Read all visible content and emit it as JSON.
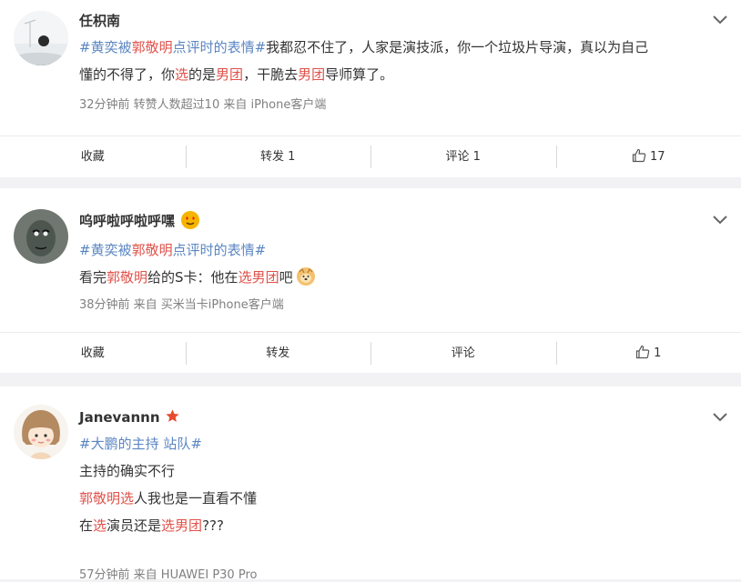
{
  "posts": [
    {
      "username": "任枳南",
      "lines": [
        [
          {
            "t": "#黄奕被",
            "c": "tag"
          },
          {
            "t": "郭敬明",
            "c": "hl"
          },
          {
            "t": "点评时的表情#",
            "c": "tag"
          },
          {
            "t": "我都忍不住了，人家是演技派，你一个垃圾片导演，真以为自己"
          }
        ],
        [
          {
            "t": "懂的不得了，你"
          },
          {
            "t": "选",
            "c": "hl"
          },
          {
            "t": "的是"
          },
          {
            "t": "男团",
            "c": "hl"
          },
          {
            "t": "，干脆去"
          },
          {
            "t": "男团",
            "c": "hl"
          },
          {
            "t": "导师算了。"
          }
        ]
      ],
      "meta": "32分钟前  转赞人数超过10   来自 iPhone客户端",
      "actions": {
        "collect": "收藏",
        "repost": "转发 1",
        "comment": "评论 1",
        "like": "17"
      }
    },
    {
      "username": "呜呼啦呼啦呼嘿",
      "lines": [
        [
          {
            "t": "#黄奕被",
            "c": "tag"
          },
          {
            "t": "郭敬明",
            "c": "hl"
          },
          {
            "t": "点评时的表情#",
            "c": "tag"
          }
        ],
        [
          {
            "t": "看完"
          },
          {
            "t": "郭敬明",
            "c": "hl"
          },
          {
            "t": "给的S卡：他在"
          },
          {
            "t": "选男团",
            "c": "hl"
          },
          {
            "t": "吧"
          }
        ]
      ],
      "meta": "38分钟前  来自 买米当卡iPhone客户端",
      "actions": {
        "collect": "收藏",
        "repost": "转发",
        "comment": "评论",
        "like": "1"
      }
    },
    {
      "username": "Janevannn",
      "lines": [
        [
          {
            "t": "#大鹏的主持 站队#",
            "c": "tag"
          }
        ],
        [
          {
            "t": "主持的确实不行"
          }
        ],
        [
          {
            "t": "郭敬明选",
            "c": "hl"
          },
          {
            "t": "人我也是一直看不懂"
          }
        ],
        [
          {
            "t": "在"
          },
          {
            "t": "选",
            "c": "hl"
          },
          {
            "t": "演员还是"
          },
          {
            "t": "选男团",
            "c": "hl"
          },
          {
            "t": "???"
          }
        ]
      ],
      "meta": "57分钟前  来自 HUAWEI P30 Pro"
    }
  ],
  "colors": {
    "tag": "#5b86c2",
    "highlight": "#e0514a",
    "meta": "#808080"
  }
}
